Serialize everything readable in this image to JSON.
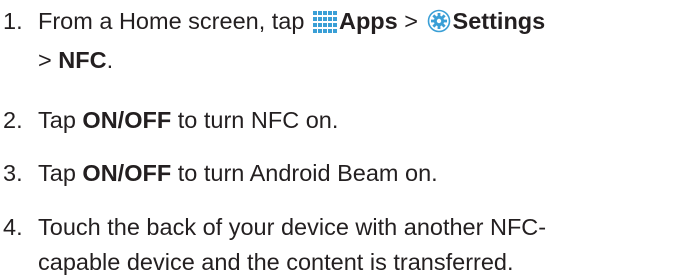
{
  "steps": [
    {
      "number": "1.",
      "parts": {
        "text_a": "From a Home screen, tap",
        "apps_label": "Apps",
        "sep1": ">",
        "settings_label": "Settings",
        "sep2": ">",
        "nfc_label": "NFC",
        "end": "."
      },
      "icons": [
        "apps-grid-icon",
        "settings-gear-icon"
      ]
    },
    {
      "number": "2.",
      "text_a": "Tap",
      "bold": "ON/OFF",
      "text_b": "to turn NFC on."
    },
    {
      "number": "3.",
      "text_a": "Tap",
      "bold": "ON/OFF",
      "text_b": "to turn Android Beam on."
    },
    {
      "number": "4.",
      "line1": "Touch the back of your device with another NFC-",
      "line2": "capable device and the content is transferred."
    }
  ],
  "colors": {
    "text": "#231f20",
    "icon_blue": "#3a9fd6"
  }
}
